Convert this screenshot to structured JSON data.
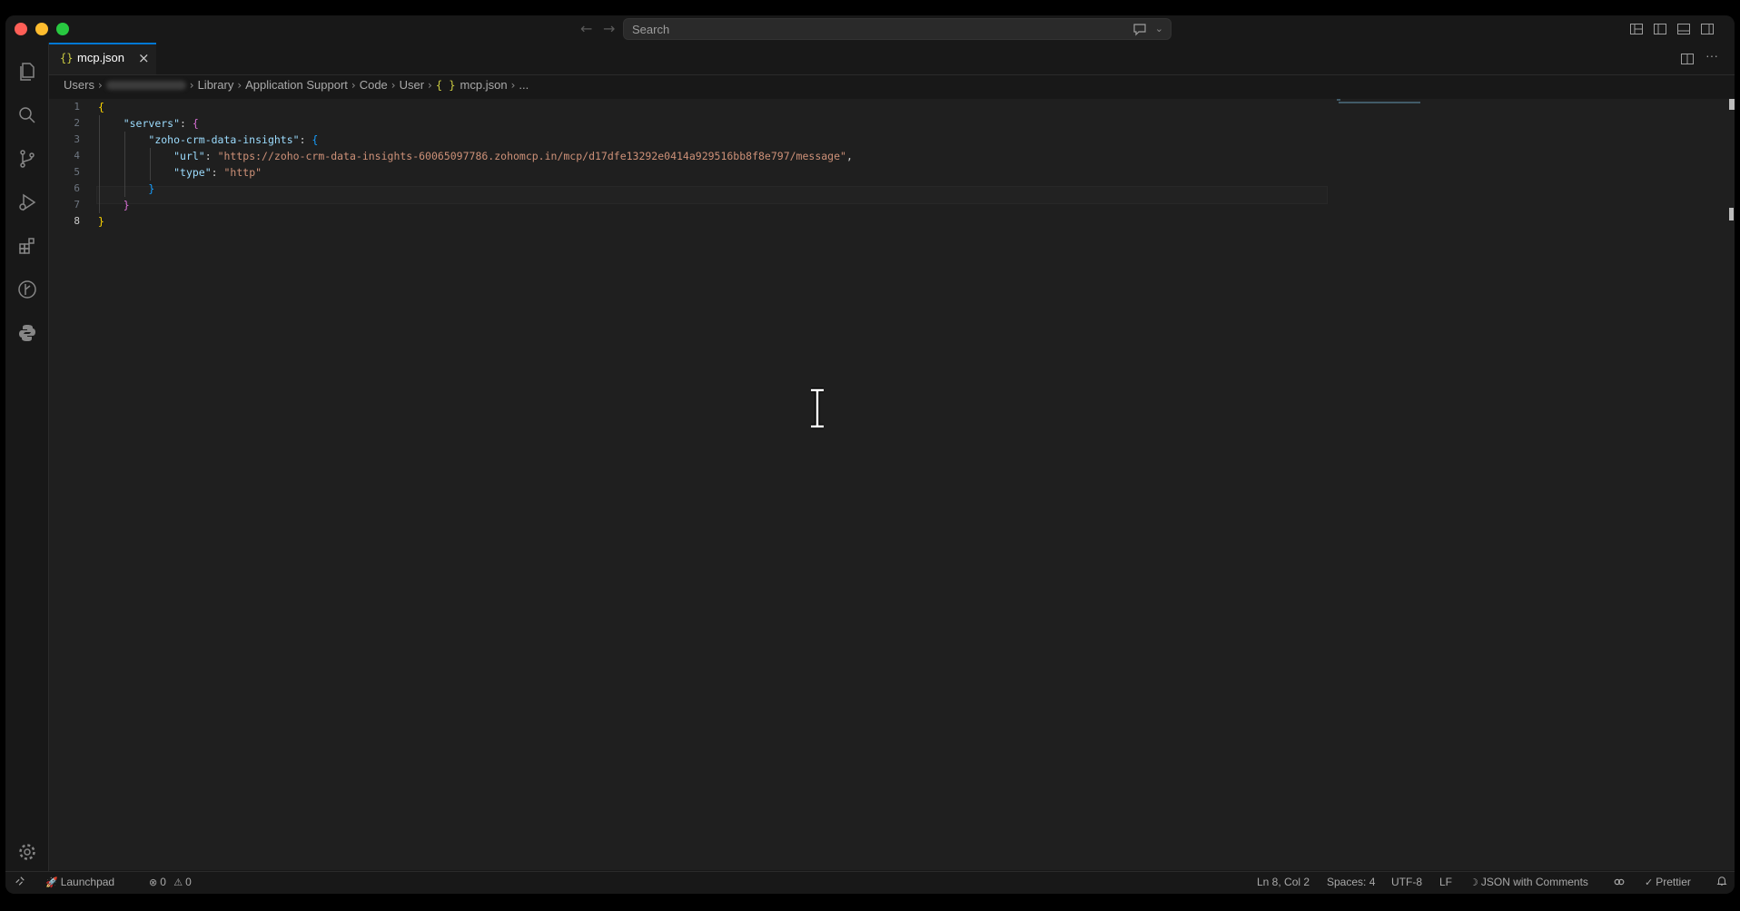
{
  "titlebar": {
    "search_label": "Search"
  },
  "tabs": [
    {
      "label": "mcp.json",
      "icon": "json-braces-icon",
      "close": "×"
    }
  ],
  "breadcrumb": {
    "items": [
      "Users",
      "Library",
      "Application Support",
      "Code",
      "User",
      "mcp.json",
      "..."
    ],
    "json_icon": "{ }"
  },
  "editor": {
    "line_numbers": [
      "1",
      "2",
      "3",
      "4",
      "5",
      "6",
      "7",
      "8"
    ],
    "active_line": "8",
    "lines": {
      "l1_brace": "{",
      "l2_key": "\"servers\"",
      "l2_colon": ": ",
      "l2_brace": "{",
      "l3_key": "\"zoho-crm-data-insights\"",
      "l3_colon": ": ",
      "l3_brace": "{",
      "l4_key": "\"url\"",
      "l4_colon": ": ",
      "l4_value": "\"https://zoho-crm-data-insights-60065097786.zohomcp.in/mcp/d17dfe13292e0414a929516bb8f8e797/message\"",
      "l4_comma": ",",
      "l5_key": "\"type\"",
      "l5_colon": ": ",
      "l5_value": "\"http\"",
      "l6_brace": "}",
      "l7_brace": "}",
      "l8_brace": "}"
    }
  },
  "statusbar": {
    "launchpad": "Launchpad",
    "errors": "0",
    "warnings": "0",
    "position": "Ln 8, Col 2",
    "spaces": "Spaces: 4",
    "encoding": "UTF-8",
    "eol": "LF",
    "language": "JSON with Comments",
    "formatter": "Prettier"
  },
  "colors": {
    "accent": "#0078d4",
    "editor_bg": "#1f1f1f",
    "chrome_bg": "#181818"
  }
}
